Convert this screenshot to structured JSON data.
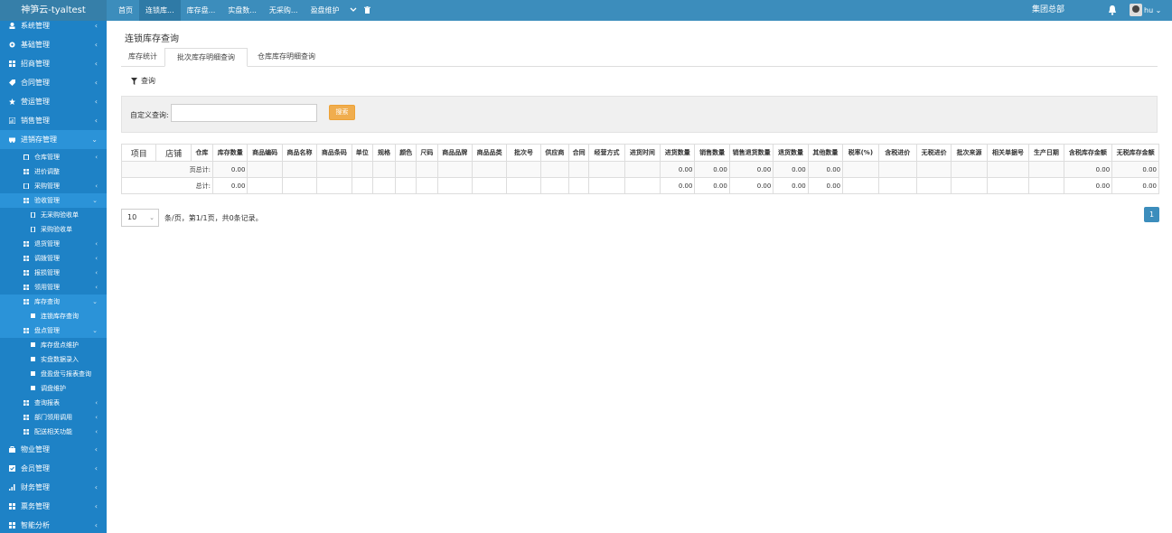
{
  "app": {
    "title": "神笋云-tyaltest"
  },
  "topnav": {
    "items": [
      "首页",
      "连锁库...",
      "库存盘...",
      "实盘数...",
      "无采购...",
      "盈盘维护"
    ],
    "more_icon": "chevron-down-icon",
    "close_icon": "trash-icon"
  },
  "header": {
    "org": "集团总部",
    "user": "hu"
  },
  "sidebar": {
    "items": [
      {
        "label": "系统管理"
      },
      {
        "label": "基础管理"
      },
      {
        "label": "招商管理"
      },
      {
        "label": "合同管理"
      },
      {
        "label": "营运管理"
      },
      {
        "label": "销售管理"
      },
      {
        "label": "进销存管理"
      }
    ],
    "sub": [
      {
        "label": "仓库管理"
      },
      {
        "label": "进价调整"
      },
      {
        "label": "采购管理"
      },
      {
        "label": "验收管理"
      }
    ],
    "sub3a": [
      {
        "label": "无采购验收单"
      },
      {
        "label": "采购验收单"
      }
    ],
    "sub2": [
      {
        "label": "退货管理"
      },
      {
        "label": "调拨管理"
      },
      {
        "label": "报损管理"
      },
      {
        "label": "领用管理"
      },
      {
        "label": "库存查询"
      }
    ],
    "sub3b": [
      {
        "label": "连锁库存查询"
      }
    ],
    "sub4": [
      {
        "label": "盘点管理"
      }
    ],
    "sub3c": [
      {
        "label": "库存盘点维护"
      },
      {
        "label": "实盘数据录入"
      },
      {
        "label": "盘盈盘亏报表查询"
      },
      {
        "label": "调盘维护"
      }
    ],
    "sub5": [
      {
        "label": "查询报表"
      },
      {
        "label": "部门领用调用"
      },
      {
        "label": "配送相关功能"
      }
    ],
    "bottom": [
      {
        "label": "物业管理"
      },
      {
        "label": "会员管理"
      },
      {
        "label": "财务管理"
      },
      {
        "label": "票务管理"
      },
      {
        "label": "智能分析"
      }
    ]
  },
  "page": {
    "title": "连锁库存查询",
    "tabs": [
      "库存统计",
      "批次库存明细查询",
      "仓库库存明细查询"
    ],
    "query_label": "查询",
    "filter_label": "自定义查询:",
    "filter_value": "",
    "search_label": "搜索"
  },
  "table": {
    "columns": [
      "项目",
      "店铺",
      "仓库",
      "库存数量",
      "商品编码",
      "商品名称",
      "商品条码",
      "单位",
      "规格",
      "颜色",
      "尺码",
      "商品品牌",
      "商品品类",
      "批次号",
      "供应商",
      "合同",
      "经营方式",
      "进货时间",
      "进货数量",
      "销售数量",
      "销售退货数量",
      "退货数量",
      "其他数量",
      "税率(%)",
      "含税进价",
      "无税进价",
      "批次来源",
      "相关单据号",
      "生产日期",
      "含税库存金额",
      "无税库存金额"
    ],
    "rows": [
      {
        "label": "页总计:",
        "qty": "0.00",
        "in": "0.00",
        "sale": "0.00",
        "sret": "0.00",
        "ret": "0.00",
        "other": "0.00",
        "tax_amt": "0.00",
        "notax_amt": "0.00"
      },
      {
        "label": "总计:",
        "qty": "0.00",
        "in": "0.00",
        "sale": "0.00",
        "sret": "0.00",
        "ret": "0.00",
        "other": "0.00",
        "tax_amt": "0.00",
        "notax_amt": "0.00"
      }
    ]
  },
  "pager": {
    "page_size": "10",
    "text": "条/页，第1/1页，共0条记录。",
    "current": "1"
  },
  "colors": {
    "topbar": "#3c8dbc",
    "sidebar": "#1e82c6",
    "accent": "#f0ad4e"
  }
}
